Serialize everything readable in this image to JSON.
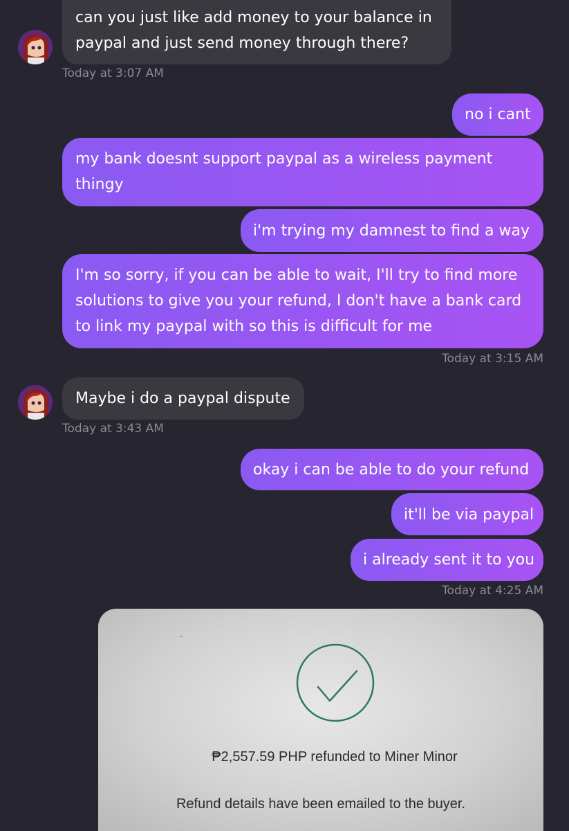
{
  "messages": {
    "m1": {
      "text": "can you just like add money to your balance in paypal and just send money through there?",
      "time": "Today at 3:07 AM"
    },
    "m2": {
      "text": "no i cant"
    },
    "m3": {
      "text": "my bank doesnt support paypal as a wireless payment thingy"
    },
    "m4": {
      "text": "i'm trying my damnest to find a way"
    },
    "m5": {
      "text": "I'm so sorry, if you can be able to wait, I'll try to find more solutions to give you your refund, I don't have a bank card to link my paypal with so this is difficult for me",
      "time": "Today at 3:15 AM"
    },
    "m6": {
      "text": "Maybe i do a paypal dispute",
      "time": "Today at 3:43 AM"
    },
    "m7": {
      "text": "okay i can be able to do your refund"
    },
    "m8": {
      "text": "it'll be via paypal"
    },
    "m9": {
      "text": "i already sent it to you",
      "time": "Today at 4:25 AM"
    }
  },
  "attachment": {
    "refund_line": "₱2,557.59 PHP refunded to Miner Minor",
    "details_line": "Refund details have been emailed to the buyer.",
    "icon": "check-circle-icon"
  },
  "colors": {
    "background": "#262530",
    "incoming_bubble": "#3a3940",
    "outgoing_gradient_start": "#8a5af2",
    "outgoing_gradient_end": "#a853f3",
    "timestamp": "#8c8b93",
    "check_green": "#2f7b56"
  }
}
